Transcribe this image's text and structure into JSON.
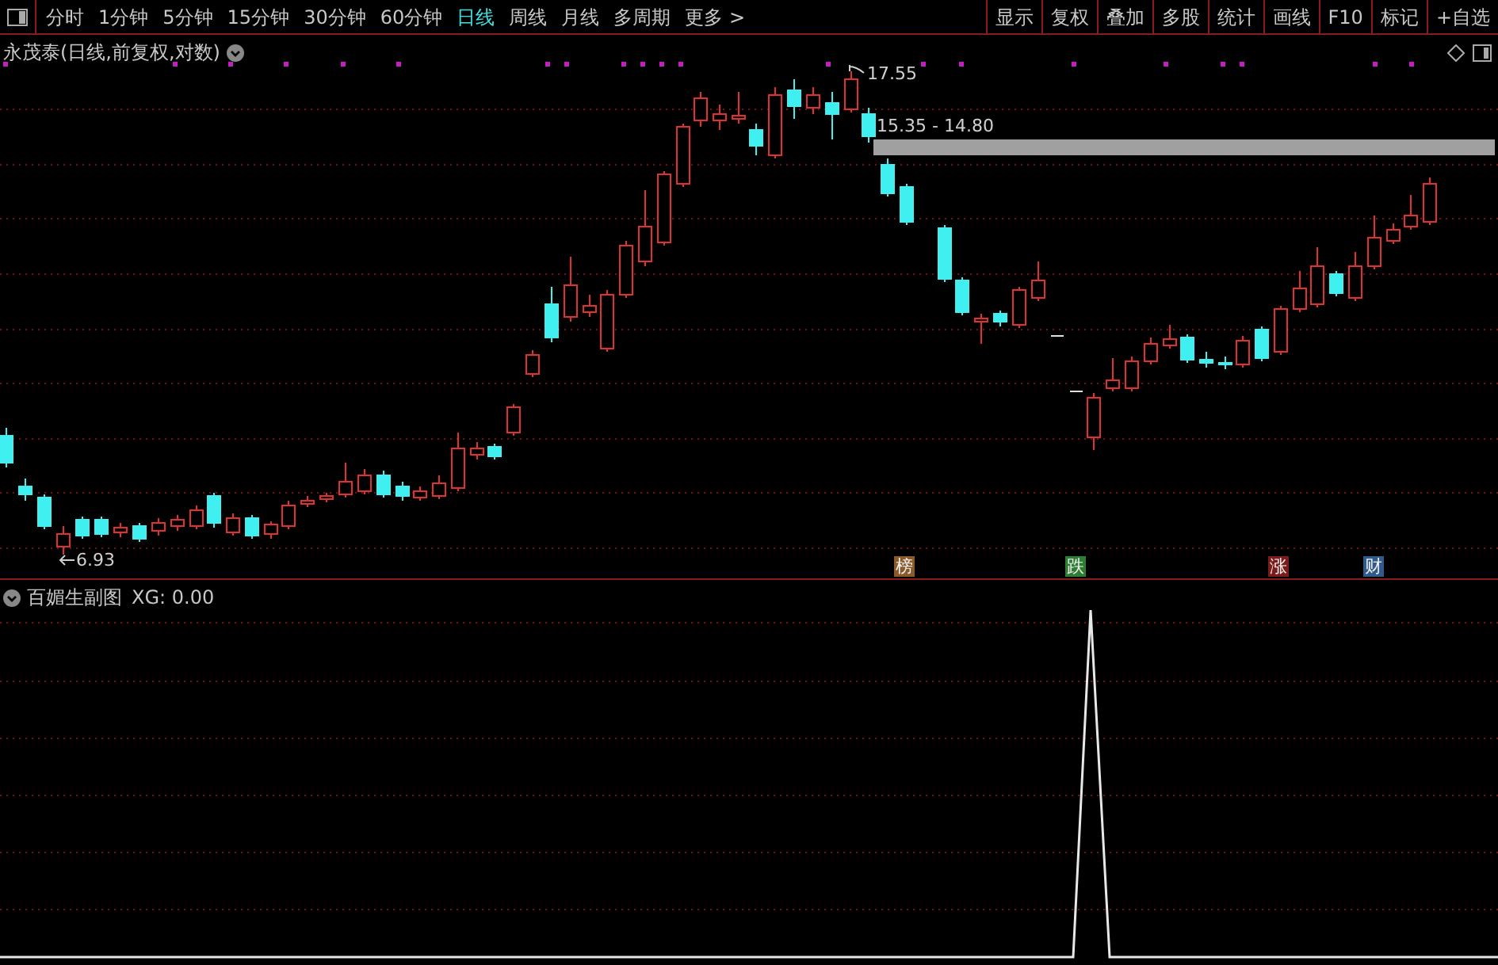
{
  "toolbar": {
    "periods": [
      {
        "label": "分时",
        "selected": false
      },
      {
        "label": "1分钟",
        "selected": false
      },
      {
        "label": "5分钟",
        "selected": false
      },
      {
        "label": "15分钟",
        "selected": false
      },
      {
        "label": "30分钟",
        "selected": false
      },
      {
        "label": "60分钟",
        "selected": false
      },
      {
        "label": "日线",
        "selected": true
      },
      {
        "label": "周线",
        "selected": false
      },
      {
        "label": "月线",
        "selected": false
      },
      {
        "label": "多周期",
        "selected": false
      },
      {
        "label": "更多 >",
        "selected": false
      }
    ],
    "tools": [
      "显示",
      "复权",
      "叠加",
      "多股",
      "统计",
      "画线",
      "F10",
      "标记",
      "+自选"
    ]
  },
  "main_chart": {
    "title": "永茂泰(日线,前复权,对数)",
    "high_label": "17.55",
    "low_label": "6.93",
    "range_label": "15.35 - 14.80",
    "event_tags": [
      {
        "label": "榜",
        "color": "#8a5a2a"
      },
      {
        "label": "跌",
        "color": "#2e7d32"
      },
      {
        "label": "涨",
        "color": "#7a1c1c"
      },
      {
        "label": "财",
        "color": "#2f5a8a"
      }
    ]
  },
  "sub_chart": {
    "title": "百媚生副图",
    "reading": "XG: 0.00"
  }
}
